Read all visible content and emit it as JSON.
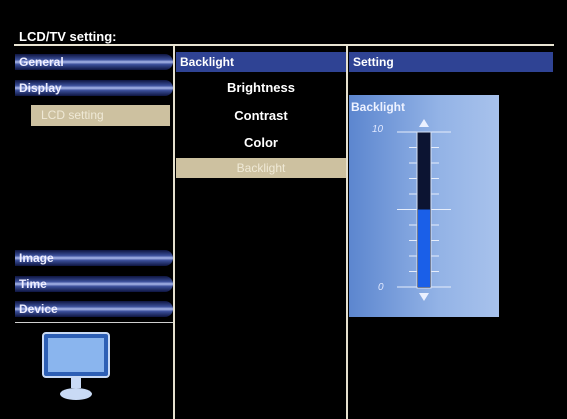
{
  "title": "LCD/TV setting:",
  "left_menu": {
    "items": [
      {
        "label": "General"
      },
      {
        "label": "Display"
      },
      {
        "label": "Image"
      },
      {
        "label": "Time"
      },
      {
        "label": "Device"
      }
    ],
    "selected_sub": "LCD setting"
  },
  "middle": {
    "header": "Backlight",
    "options": [
      "Brightness",
      "Contrast",
      "Color"
    ],
    "selected": "Backlight"
  },
  "right": {
    "header": "Setting",
    "slider": {
      "label": "Backlight",
      "max_label": "10",
      "min_label": "0",
      "max": 10,
      "min": 0,
      "value": 5,
      "fill_color": "#1a5fe8"
    }
  },
  "icons": {
    "monitor": "monitor-icon"
  }
}
